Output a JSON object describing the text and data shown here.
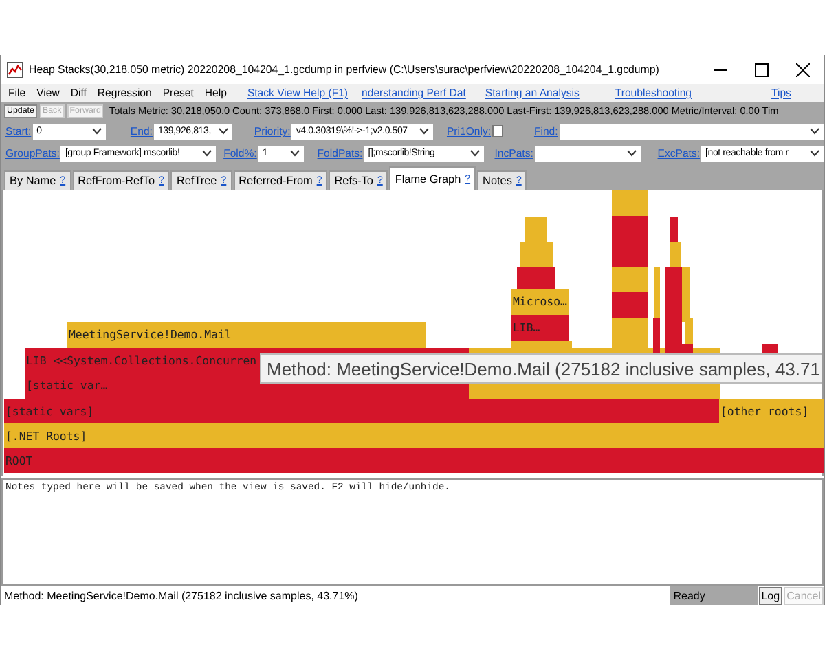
{
  "window": {
    "title": "Heap Stacks(30,218,050 metric) 20220208_104204_1.gcdump in perfview (C:\\Users\\surac\\perfview\\20220208_104204_1.gcdump)"
  },
  "menu": [
    "File",
    "View",
    "Diff",
    "Regression",
    "Preset",
    "Help"
  ],
  "help_links": [
    "Stack View Help (F1)",
    "nderstanding Perf Dat",
    "Starting an Analysis",
    "Troubleshooting",
    "Tips"
  ],
  "toolbar": {
    "buttons": [
      {
        "label": "Update",
        "disabled": false
      },
      {
        "label": "Back",
        "disabled": true
      },
      {
        "label": "Forward",
        "disabled": true
      }
    ],
    "totals": "Totals Metric: 30,218,050.0 Count: 373,868.0 First: 0.000 Last: 139,926,813,623,288.000 Last-First: 139,926,813,623,288.000 Metric/Interval: 0.00 Tim"
  },
  "filters": [
    [
      {
        "label": "Start:",
        "kind": "combo",
        "value": "0"
      },
      {
        "label": "End:",
        "kind": "combo",
        "value": "139,926,813,"
      },
      {
        "label": "Priority:",
        "kind": "combo",
        "value": "v4.0.30319\\%!->-1;v2.0.507"
      },
      {
        "label": "Pri1Only:",
        "kind": "check",
        "checked": false
      },
      {
        "label": "Find:",
        "kind": "combo"
      }
    ],
    [
      {
        "label": "GroupPats:",
        "kind": "combo",
        "value": "[group Framework] mscorlib!"
      },
      {
        "label": "Fold%:",
        "kind": "combo",
        "value": "1"
      },
      {
        "label": "FoldPats:",
        "kind": "combo",
        "value": "[];mscorlib!String"
      },
      {
        "label": "IncPats:",
        "kind": "combo"
      },
      {
        "label": "ExcPats:",
        "kind": "combo",
        "value": "[not reachable from r"
      }
    ]
  ],
  "tabs": [
    {
      "label": "By Name",
      "help": "?",
      "selected": false
    },
    {
      "label": "RefFrom-RefTo",
      "help": "?",
      "selected": false
    },
    {
      "label": "RefTree",
      "help": "?",
      "selected": false
    },
    {
      "label": "Referred-From",
      "help": "?",
      "selected": false
    },
    {
      "label": "Refs-To",
      "help": "?",
      "selected": false
    },
    {
      "label": "Flame Graph",
      "help": "?",
      "selected": true
    },
    {
      "label": "Notes",
      "help": "?",
      "selected": false
    }
  ],
  "flame_graph": {
    "frames": [
      {
        "label": "MeetingService!Demo.Mail",
        "color": "#e8b628"
      },
      {
        "label": "LIB <<System.Collections.Concurren",
        "color": "#d4152a"
      },
      {
        "label": "[static var…",
        "color": "#d4152a"
      },
      {
        "label": "[static vars]",
        "color": "#d4152a"
      },
      {
        "label": "[other roots]",
        "color": "#e8b628"
      },
      {
        "label": "[.NET Roots]",
        "color": "#e8b628"
      },
      {
        "label": "ROOT",
        "color": "#d4152a"
      },
      {
        "label": "Microso…",
        "color": "#e8b628"
      },
      {
        "label": "LIB…",
        "color": "#d4152a"
      }
    ],
    "tooltip": "Method: MeetingService!Demo.Mail (275182 inclusive samples, 43.71"
  },
  "notes": "Notes typed here will be saved when the view is saved. F2 will hide/unhide.",
  "status_bar": {
    "message": "Method: MeetingService!Demo.Mail (275182 inclusive samples, 43.71%)",
    "state": "Ready",
    "buttons": [
      {
        "label": "Log",
        "disabled": false
      },
      {
        "label": "Cancel",
        "disabled": true
      }
    ]
  }
}
